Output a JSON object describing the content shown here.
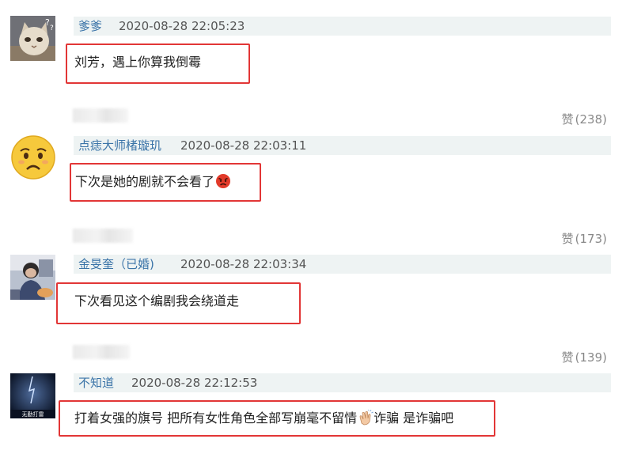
{
  "comments": [
    {
      "avatar_icon": "cat-avatar-icon",
      "username": "爹爹",
      "time": "2020-08-28 22:05:23",
      "text": "刘芳，遇上你算我倒霉",
      "emoji": ""
    },
    {
      "avatar_icon": "sad-face-avatar-icon",
      "username": "点痣大师楮璇玑",
      "time": "2020-08-28 22:03:11",
      "text": "下次是她的剧就不会看了",
      "emoji": "angry-face-icon",
      "likes_label": "赞",
      "likes_count": "(238)"
    },
    {
      "avatar_icon": "person-photo-avatar-icon",
      "username": "金旻奎（已婚)",
      "time": "2020-08-28 22:03:34",
      "text": "下次看见这个编剧我会绕道走",
      "emoji": "",
      "likes_label": "赞",
      "likes_count": "(173)"
    },
    {
      "avatar_icon": "dark-poster-avatar-icon",
      "avatar_caption": "无勤打雷",
      "username": "不知道",
      "time": "2020-08-28 22:12:53",
      "text_a": "打着女强的旗号 把所有女性角色全部写崩毫不留情",
      "emoji": "clapping-hands-icon",
      "text_b": "诈骗 是诈骗吧",
      "likes_label": "赞",
      "likes_count": "(139)"
    }
  ],
  "colors": {
    "username": "#3b74a8",
    "highlight_border": "#e23636",
    "header_background": "#eef3f3"
  }
}
